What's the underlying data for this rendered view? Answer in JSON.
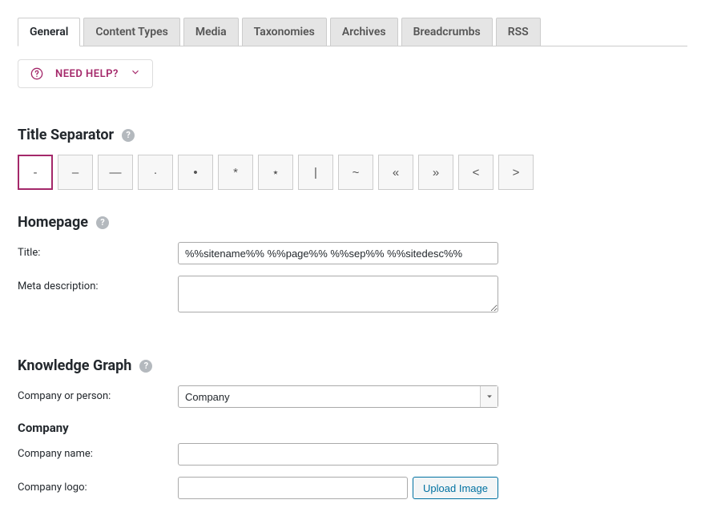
{
  "tabs": [
    {
      "label": "General",
      "active": true
    },
    {
      "label": "Content Types",
      "active": false
    },
    {
      "label": "Media",
      "active": false
    },
    {
      "label": "Taxonomies",
      "active": false
    },
    {
      "label": "Archives",
      "active": false
    },
    {
      "label": "Breadcrumbs",
      "active": false
    },
    {
      "label": "RSS",
      "active": false
    }
  ],
  "need_help": {
    "label": "NEED HELP?"
  },
  "title_separator": {
    "heading": "Title Separator",
    "options": [
      "-",
      "–",
      "—",
      "·",
      "•",
      "*",
      "⋆",
      "|",
      "~",
      "«",
      "»",
      "<",
      ">"
    ],
    "selected_index": 0
  },
  "homepage": {
    "heading": "Homepage",
    "title_label": "Title:",
    "title_value": "%%sitename%% %%page%% %%sep%% %%sitedesc%%",
    "meta_label": "Meta description:",
    "meta_value": ""
  },
  "knowledge_graph": {
    "heading": "Knowledge Graph",
    "company_or_person_label": "Company or person:",
    "company_or_person_value": "Company",
    "company_heading": "Company",
    "company_name_label": "Company name:",
    "company_name_value": "",
    "company_logo_label": "Company logo:",
    "company_logo_value": "",
    "upload_label": "Upload Image"
  }
}
